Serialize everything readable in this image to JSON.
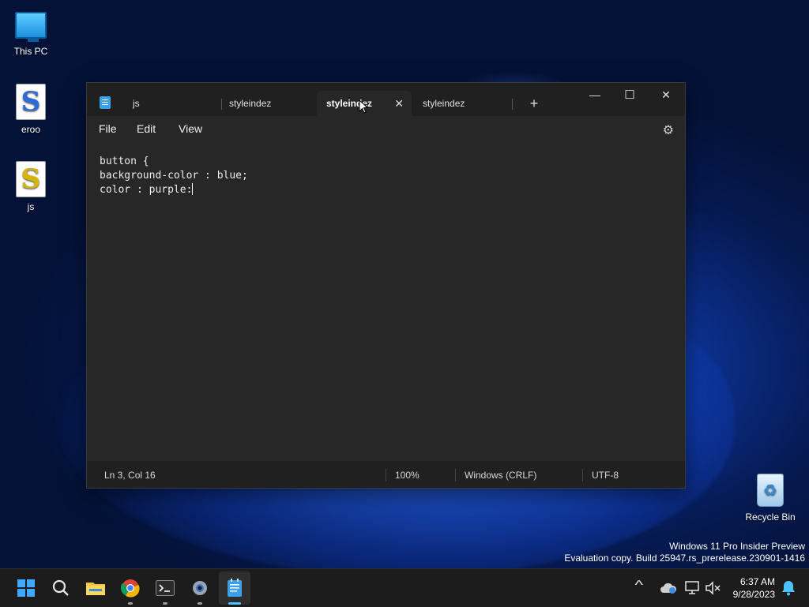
{
  "desktop": {
    "icons": [
      {
        "label": "This PC"
      },
      {
        "label": "eroo"
      },
      {
        "label": "js"
      },
      {
        "label": "Recycle Bin"
      }
    ],
    "watermark_line1": "Windows 11 Pro Insider Preview",
    "watermark_line2": "Evaluation copy. Build 25947.rs_prerelease.230901-1416"
  },
  "notepad": {
    "tabs": [
      {
        "label": "js",
        "active": false
      },
      {
        "label": "styleindez",
        "active": false
      },
      {
        "label": "styleindez",
        "active": true
      },
      {
        "label": "styleindez",
        "active": false
      }
    ],
    "close_glyph": "✕",
    "new_tab_glyph": "+",
    "window_controls": {
      "minimize": "—",
      "maximize": "☐",
      "close": "✕"
    },
    "menu": [
      "File",
      "Edit",
      "View"
    ],
    "editor_lines": [
      "button {",
      "background-color : blue;",
      "color : purple:"
    ],
    "status": {
      "position": "Ln 3, Col 16",
      "zoom": "100%",
      "line_ending": "Windows (CRLF)",
      "encoding": "UTF-8"
    }
  },
  "taskbar": {
    "apps": [
      "start-icon",
      "search-icon",
      "file-explorer-icon",
      "chrome-icon",
      "terminal-icon",
      "settings-icon",
      "notepad-icon"
    ],
    "tray_chevron": "^",
    "time": "6:37 AM",
    "date": "9/28/2023"
  }
}
